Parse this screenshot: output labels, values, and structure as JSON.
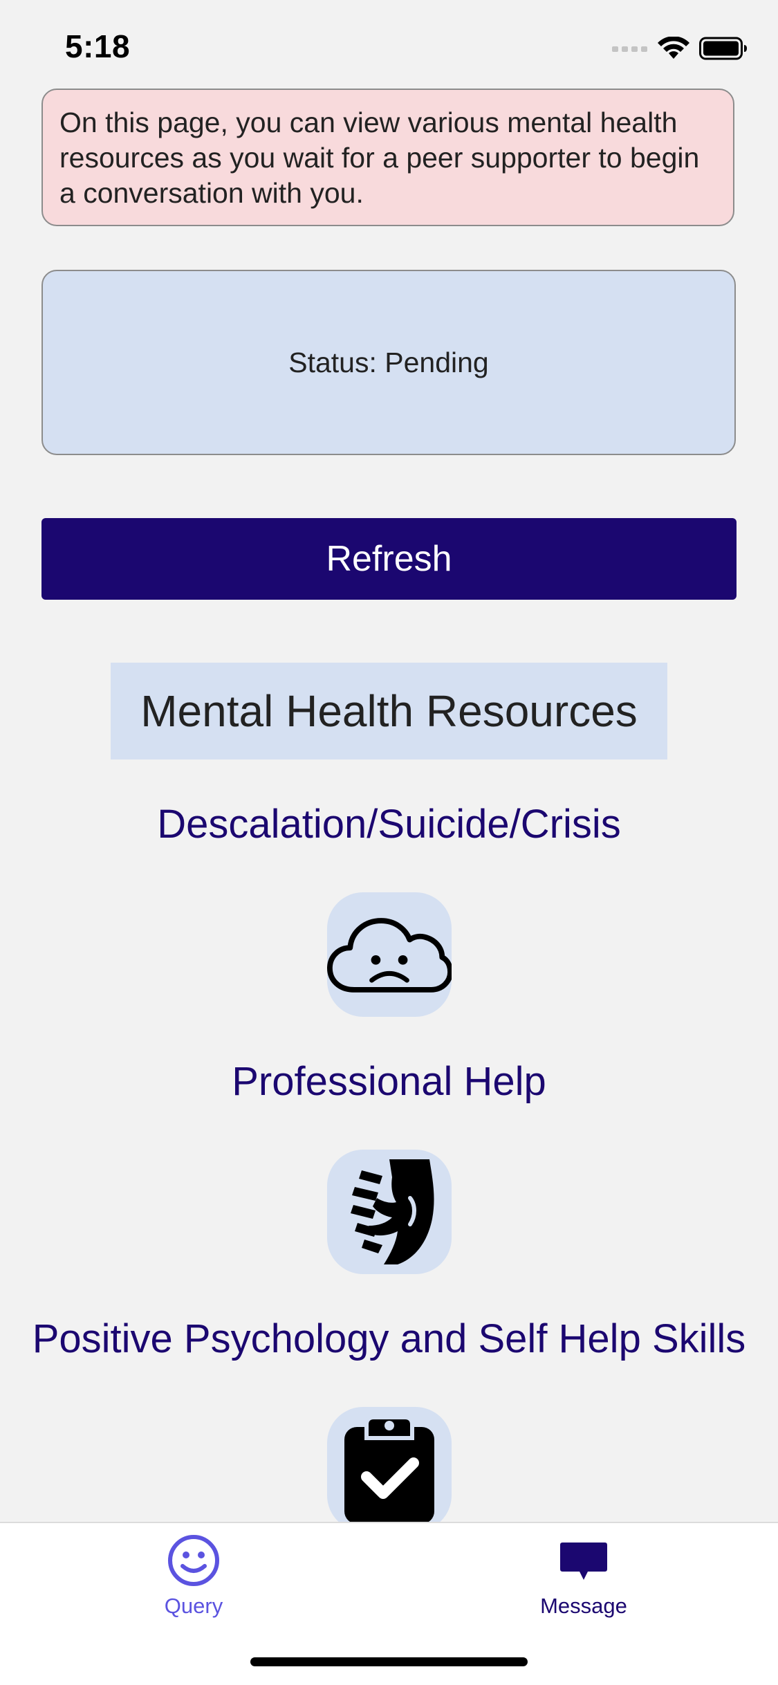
{
  "status_bar": {
    "time": "5:18"
  },
  "info_banner": {
    "text": "On this page, you can view various mental health resources as you wait for a peer supporter to begin a conversation with you."
  },
  "status_card": {
    "text": "Status: Pending"
  },
  "refresh_button": {
    "label": "Refresh"
  },
  "resources": {
    "heading": "Mental Health Resources",
    "items": [
      {
        "title": "Descalation/Suicide/Crisis",
        "icon": "sad-cloud-icon"
      },
      {
        "title": "Professional Help",
        "icon": "helping-hand-icon"
      },
      {
        "title": "Positive Psychology and Self Help Skills",
        "icon": "clipboard-check-icon"
      }
    ]
  },
  "tab_bar": {
    "tabs": [
      {
        "label": "Query",
        "icon": "smiley-icon",
        "color": "#5b53e0"
      },
      {
        "label": "Message",
        "icon": "message-icon",
        "color": "#1b0770"
      }
    ]
  },
  "colors": {
    "accent": "#1b0770",
    "banner_bg": "#f8dadc",
    "card_bg": "#d5e0f2",
    "page_bg": "#f2f2f2"
  }
}
